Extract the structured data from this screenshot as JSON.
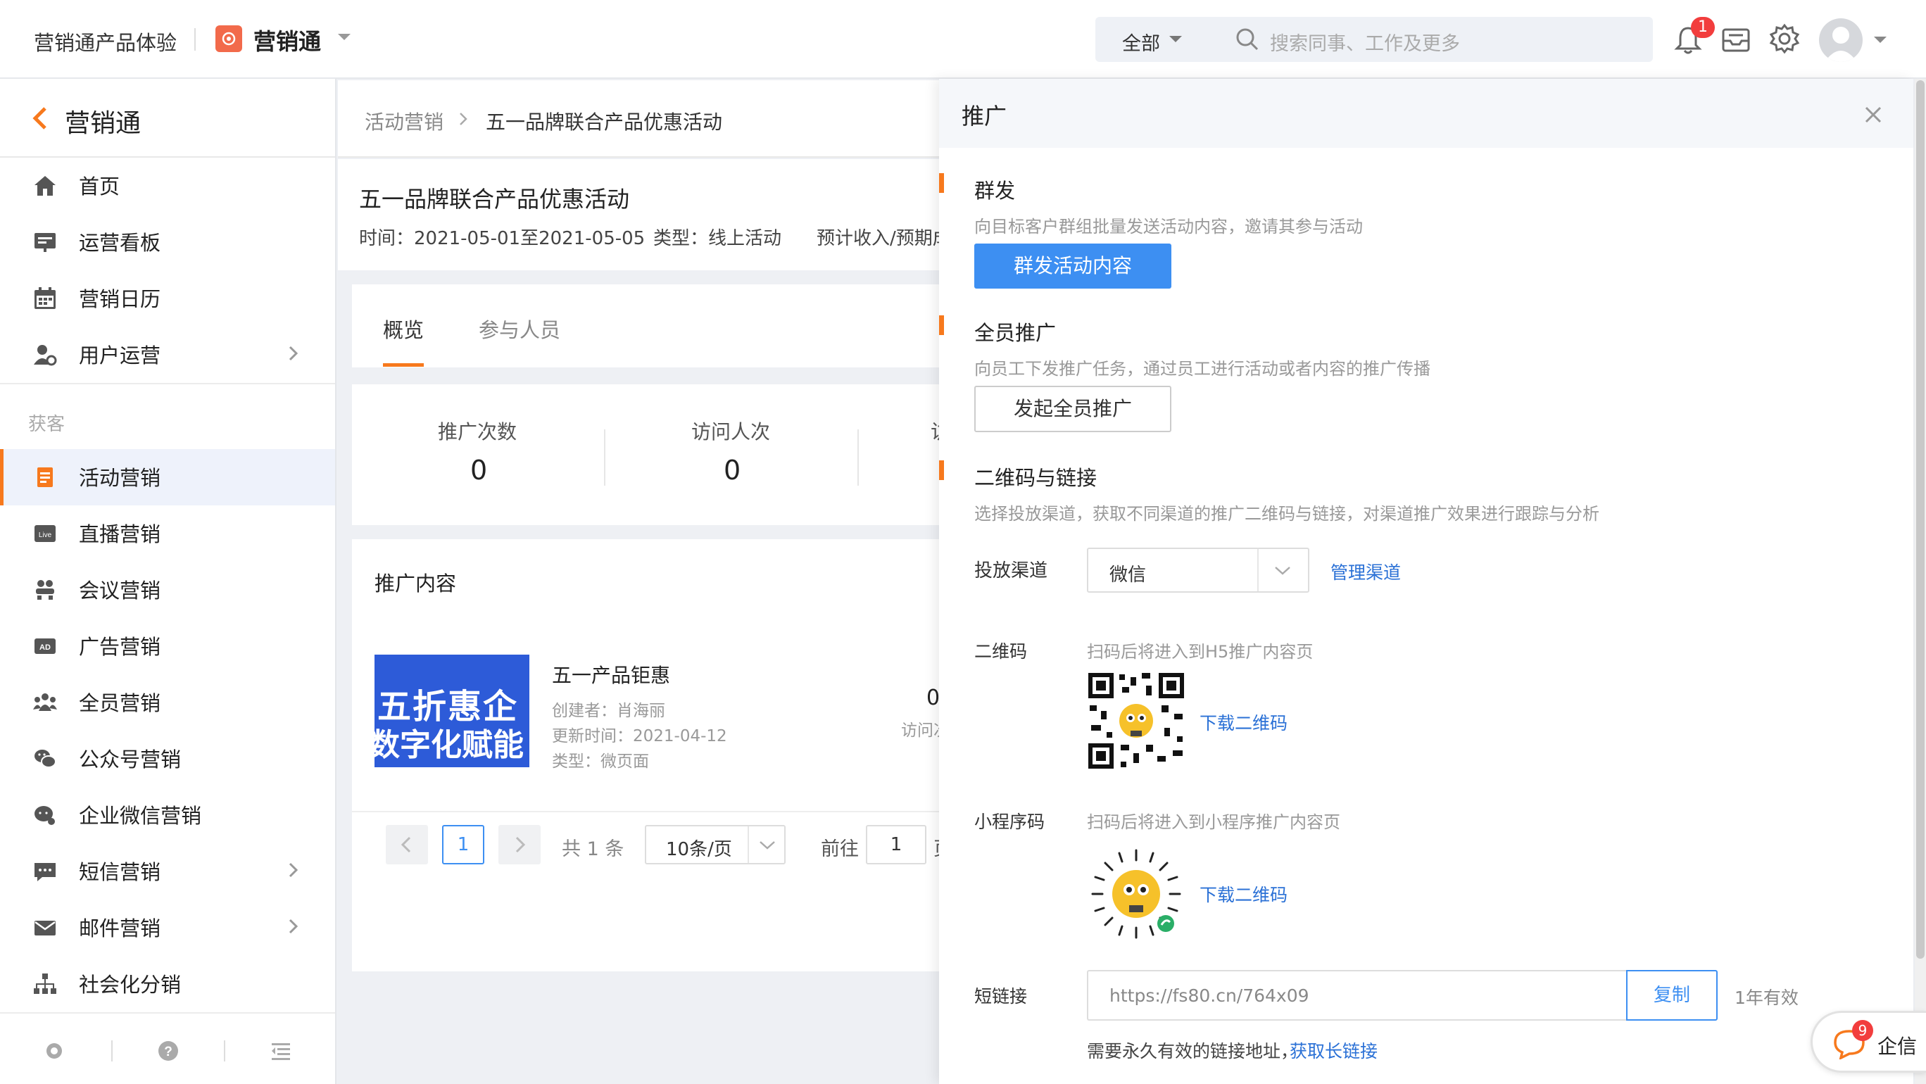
{
  "topbar": {
    "app_name": "营销通产品体验",
    "product_name": "营销通",
    "scope_select": "全部",
    "search_placeholder": "搜索同事、工作及更多",
    "notification_count": "1"
  },
  "sidebar": {
    "back_title": "营销通",
    "items_top": [
      {
        "label": "首页",
        "icon": "home-icon"
      },
      {
        "label": "运营看板",
        "icon": "dashboard-icon"
      },
      {
        "label": "营销日历",
        "icon": "calendar-icon"
      },
      {
        "label": "用户运营",
        "icon": "user-settings-icon"
      }
    ],
    "section_label": "获客",
    "items_acq": [
      {
        "label": "活动营销",
        "icon": "activity-doc-icon"
      },
      {
        "label": "直播营销",
        "icon": "live-icon"
      },
      {
        "label": "会议营销",
        "icon": "meeting-icon"
      },
      {
        "label": "广告营销",
        "icon": "ad-icon"
      },
      {
        "label": "全员营销",
        "icon": "team-icon"
      },
      {
        "label": "公众号营销",
        "icon": "wechat-icon"
      },
      {
        "label": "企业微信营销",
        "icon": "wework-icon"
      },
      {
        "label": "短信营销",
        "icon": "sms-icon"
      },
      {
        "label": "邮件营销",
        "icon": "mail-icon"
      },
      {
        "label": "社会化分销",
        "icon": "distribution-icon"
      }
    ]
  },
  "main": {
    "breadcrumb_parent": "活动营销",
    "breadcrumb_current": "五一品牌联合产品优惠活动",
    "title": "五一品牌联合产品优惠活动",
    "meta_time": "时间：2021-05-01至2021-05-05",
    "meta_type": "类型：线上活动",
    "meta_income": "预计收入/预期成",
    "tabs": [
      "概览",
      "参与人员"
    ],
    "stats": [
      {
        "label": "推广次数",
        "value": "0"
      },
      {
        "label": "访问人次",
        "value": "0"
      },
      {
        "label": "访"
      }
    ],
    "promo_section_title": "推广内容",
    "promo_item": {
      "thumb_line1": "五折惠企",
      "thumb_line2": "数字化赋能",
      "title": "五一产品钜惠",
      "creator": "创建者：肖海丽",
      "updated": "更新时间：2021-04-12",
      "type": "类型：微页面",
      "visit_value": "0",
      "visit_label": "访问次"
    },
    "pagination": {
      "current_page": "1",
      "total": "共 1 条",
      "page_size": "10条/页",
      "goto_label": "前往",
      "goto_value": "1",
      "goto_suffix": "页"
    }
  },
  "panel": {
    "title": "推广",
    "mass": {
      "title": "群发",
      "desc": "向目标客户群组批量发送活动内容，邀请其参与活动",
      "button": "群发活动内容"
    },
    "staff": {
      "title": "全员推广",
      "desc": "向员工下发推广任务，通过员工进行活动或者内容的推广传播",
      "button": "发起全员推广"
    },
    "qr": {
      "title": "二维码与链接",
      "desc": "选择投放渠道，获取不同渠道的推广二维码与链接，对渠道推广效果进行跟踪与分析",
      "channel_label": "投放渠道",
      "channel_value": "微信",
      "manage_link": "管理渠道",
      "qrcode_label": "二维码",
      "qrcode_hint": "扫码后将进入到H5推广内容页",
      "download_qr": "下载二维码",
      "mini_label": "小程序码",
      "mini_hint": "扫码后将进入到小程序推广内容页",
      "download_mini": "下载二维码",
      "short_label": "短链接",
      "short_value": "https://fs80.cn/764x09",
      "copy_button": "复制",
      "validity": "1年有效",
      "long_hint": "需要永久有效的链接地址，",
      "long_link": "获取长链接"
    }
  },
  "chat_widget": {
    "label": "企信",
    "badge": "9"
  },
  "colors": {
    "accent": "#f7791d",
    "primary": "#3d8ff2",
    "link": "#2b71d6",
    "badge": "#f23d3d"
  }
}
